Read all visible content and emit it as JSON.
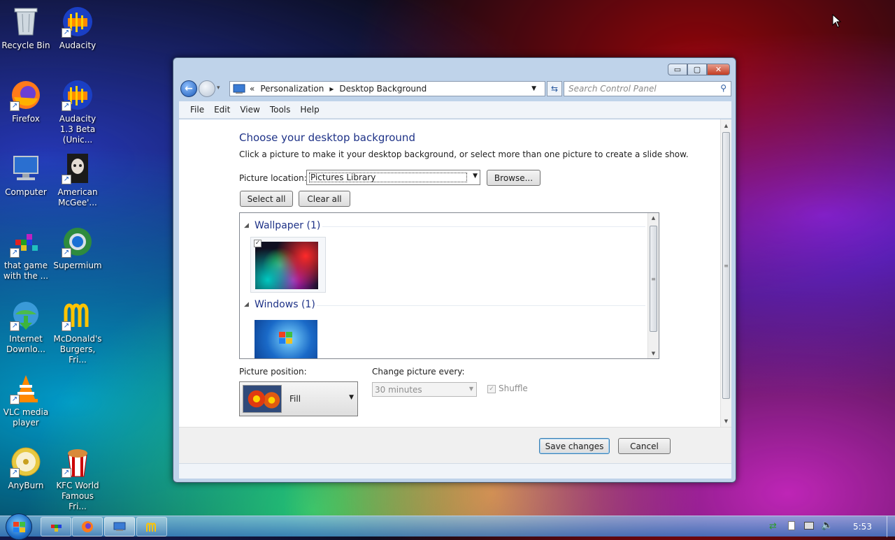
{
  "desktop": {
    "icons": [
      {
        "label": "Recycle Bin"
      },
      {
        "label": "Audacity"
      },
      {
        "label": "Firefox"
      },
      {
        "label": "Audacity 1.3 Beta (Unic..."
      },
      {
        "label": "Computer"
      },
      {
        "label": "American McGee'..."
      },
      {
        "label": "that game with the ..."
      },
      {
        "label": "Supermium"
      },
      {
        "label": "Internet Downlo..."
      },
      {
        "label": "McDonald's Burgers, Fri..."
      },
      {
        "label": "VLC media player"
      },
      {
        "label": "KFC World Famous Fri..."
      },
      {
        "label": "AnyBurn"
      }
    ]
  },
  "window": {
    "controls": {
      "minimize": "▭",
      "maximize": "▢",
      "close": "✕"
    },
    "breadcrumb": {
      "chevron": "«",
      "item1": "Personalization",
      "sep": "▸",
      "item2": "Desktop Background"
    },
    "search_placeholder": "Search Control Panel",
    "menu": [
      {
        "label": "File"
      },
      {
        "label": "Edit"
      },
      {
        "label": "View"
      },
      {
        "label": "Tools"
      },
      {
        "label": "Help"
      }
    ],
    "heading": "Choose your desktop background",
    "subheading": "Click a picture to make it your desktop background, or select more than one picture to create a slide show.",
    "picture_location_label": "Picture location:",
    "picture_location_value": "Pictures Library",
    "browse_label": "Browse...",
    "select_all_label": "Select all",
    "clear_all_label": "Clear all",
    "groups": [
      {
        "title": "Wallpaper (1)"
      },
      {
        "title": "Windows (1)"
      }
    ],
    "picture_position_label": "Picture position:",
    "picture_position_value": "Fill",
    "change_picture_label": "Change picture every:",
    "change_picture_value": "30 minutes",
    "shuffle_label": "Shuffle",
    "save_label": "Save changes",
    "cancel_label": "Cancel"
  },
  "taskbar": {
    "clock": "5:53"
  }
}
